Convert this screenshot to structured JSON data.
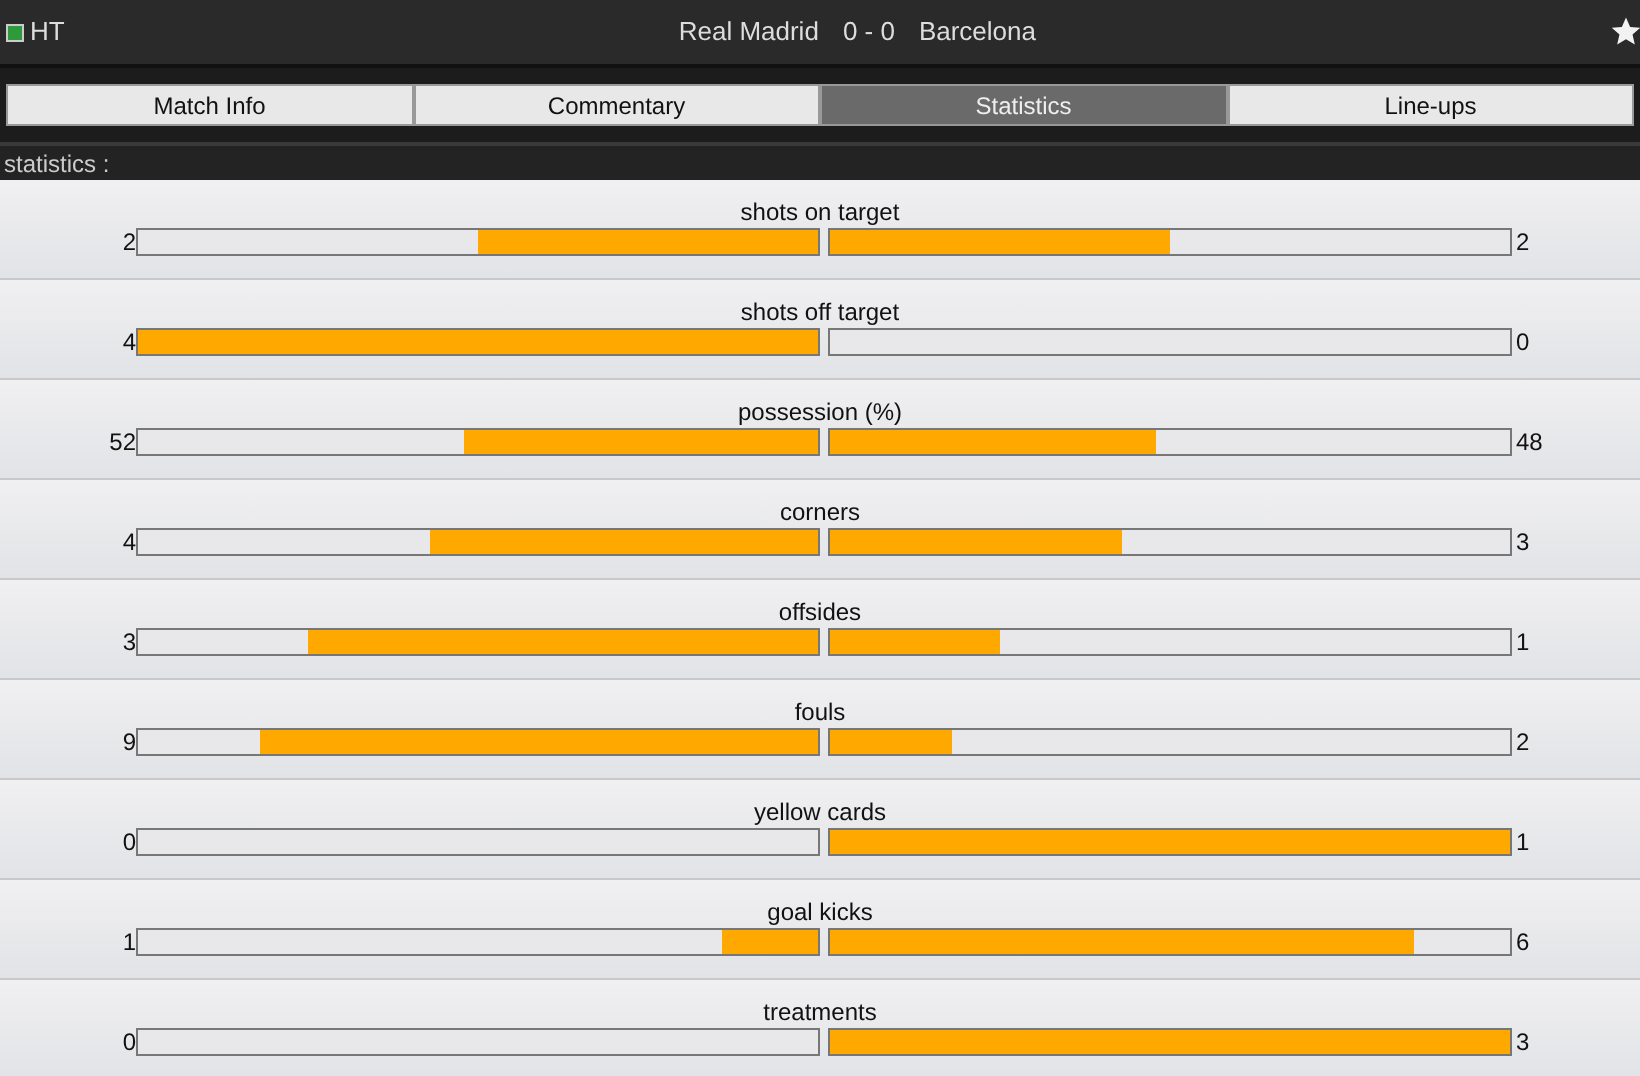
{
  "header": {
    "status": "HT",
    "home": "Real Madrid",
    "score": "0 - 0",
    "away": "Barcelona"
  },
  "tabs": [
    {
      "label": "Match Info",
      "selected": false
    },
    {
      "label": "Commentary",
      "selected": false
    },
    {
      "label": "Statistics",
      "selected": true
    },
    {
      "label": "Line-ups",
      "selected": false
    }
  ],
  "section_title": "statistics :",
  "stats": [
    {
      "label": "shots on target",
      "home": "2",
      "away": "2",
      "home_bar": {
        "level": 0.5
      },
      "away_bar": {
        "level": 0.5
      }
    },
    {
      "label": "shots off target",
      "home": "4",
      "away": "0",
      "home_bar": {
        "level": 1
      },
      "away_bar": {
        "level": 0
      }
    },
    {
      "label": "possession (%)",
      "home": "52",
      "away": "48",
      "home_bar": {
        "level": 0.52
      },
      "away_bar": {
        "level": 0.48
      }
    },
    {
      "label": "corners",
      "home": "4",
      "away": "3",
      "home_bar": {
        "level": 0.57
      },
      "away_bar": {
        "level": 0.43
      }
    },
    {
      "label": "offsides",
      "home": "3",
      "away": "1",
      "home_bar": {
        "level": 0.75
      },
      "away_bar": {
        "level": 0.25
      }
    },
    {
      "label": "fouls",
      "home": "9",
      "away": "2",
      "home_bar": {
        "level": 0.82
      },
      "away_bar": {
        "level": 0.18
      }
    },
    {
      "label": "yellow cards",
      "home": "0",
      "away": "1",
      "home_bar": {
        "level": 0
      },
      "away_bar": {
        "level": 1
      }
    },
    {
      "label": "goal kicks",
      "home": "1",
      "away": "6",
      "home_bar": {
        "level": 0.14
      },
      "away_bar": {
        "level": 0.86
      }
    },
    {
      "label": "treatments",
      "home": "0",
      "away": "3",
      "home_bar": {
        "level": 0
      },
      "away_bar": {
        "level": 1
      }
    }
  ]
}
